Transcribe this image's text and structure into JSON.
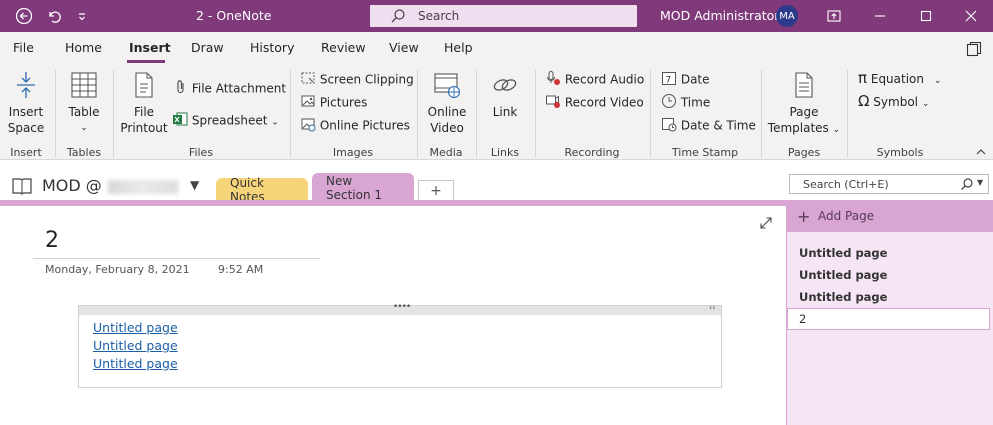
{
  "titlebar": {
    "title": "2 - OneNote",
    "search_label": "Search",
    "user": "MOD Administrator",
    "avatar": "MA",
    "icons": [
      "back-icon",
      "undo-icon",
      "customize-icon",
      "fullscreen-icon",
      "minimize-icon",
      "maximize-icon",
      "close-icon"
    ]
  },
  "menu": {
    "items": [
      "File",
      "Home",
      "Insert",
      "Draw",
      "History",
      "Review",
      "View",
      "Help"
    ],
    "active": "Insert"
  },
  "ribbon": {
    "insert_space": [
      "Insert",
      "Space"
    ],
    "table": "Table",
    "file_printout": [
      "File",
      "Printout"
    ],
    "file_attachment": "File Attachment",
    "spreadsheet": "Spreadsheet",
    "screen_clipping": "Screen Clipping",
    "pictures": "Pictures",
    "online_pictures": "Online Pictures",
    "online_video": [
      "Online",
      "Video"
    ],
    "link": "Link",
    "record_audio": "Record Audio",
    "record_video": "Record Video",
    "date": "Date",
    "time": "Time",
    "date_time": "Date & Time",
    "page_templates": [
      "Page",
      "Templates"
    ],
    "equation": "Equation",
    "symbol": "Symbol",
    "groups": [
      "Insert",
      "Tables",
      "Files",
      "Images",
      "Media",
      "Links",
      "Recording",
      "Time Stamp",
      "Pages",
      "Symbols"
    ]
  },
  "notebook": {
    "name": "MOD @",
    "sections": [
      "Quick Notes",
      "New Section 1"
    ],
    "active_section": "New Section 1",
    "search_placeholder": "Search (Ctrl+E)"
  },
  "page": {
    "title": "2",
    "date": "Monday, February 8, 2021",
    "time": "9:52 AM",
    "links": [
      "Untitled page",
      "Untitled page",
      "Untitled page"
    ]
  },
  "pages_pane": {
    "add_page": "Add Page",
    "pages": [
      "Untitled page",
      "Untitled page",
      "Untitled page"
    ],
    "selected": "2"
  },
  "colors": {
    "accent": "#80397b",
    "section_quick_notes": "#f6d47a",
    "section_new": "#d9a6d4",
    "link": "#1a5fa8"
  }
}
